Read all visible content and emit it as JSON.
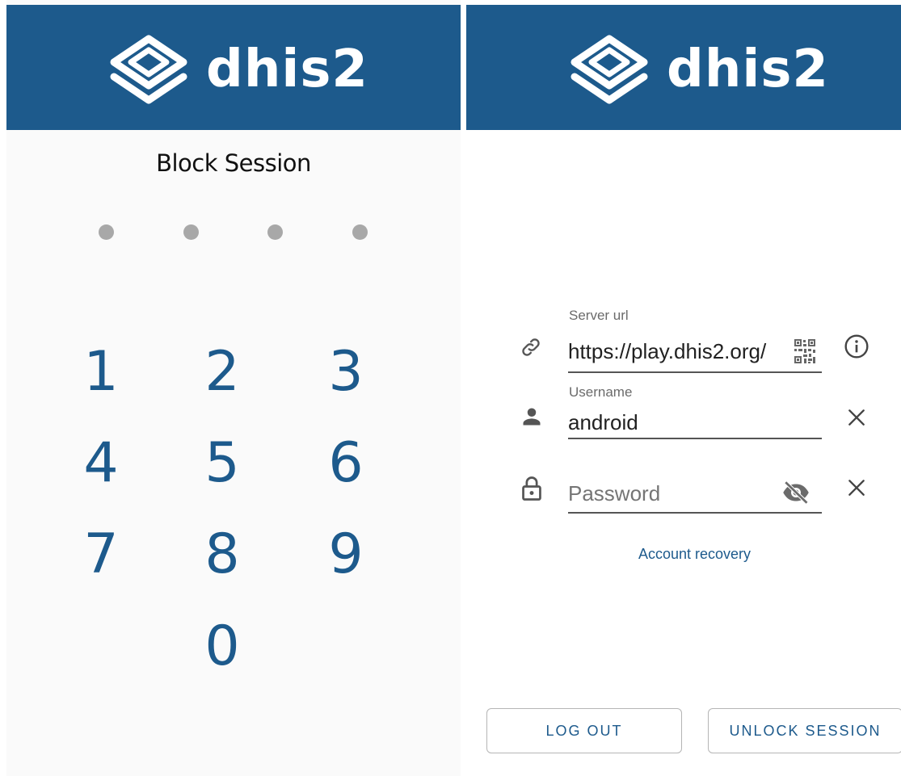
{
  "colors": {
    "brand": "#1d5a8c",
    "pin_dot": "#a8a8a8",
    "text": "#212121",
    "label": "#6b6b6b"
  },
  "left_screen": {
    "logo_text": "dhis2",
    "title": "Block Session",
    "pin_dots": 4,
    "keypad": [
      "1",
      "2",
      "3",
      "4",
      "5",
      "6",
      "7",
      "8",
      "9",
      "0"
    ]
  },
  "right_screen": {
    "logo_text": "dhis2",
    "server_url": {
      "label": "Server url",
      "value": "https://play.dhis2.org/",
      "icon": "link-icon",
      "action_icons": [
        "qr-code-icon",
        "info-icon"
      ]
    },
    "username": {
      "label": "Username",
      "value": "android",
      "icon": "person-icon",
      "clear_icon": "close-icon"
    },
    "password": {
      "placeholder": "Password",
      "value": "",
      "icon": "lock-icon",
      "visibility_icon": "eye-off-icon",
      "clear_icon": "close-icon"
    },
    "account_recovery": "Account recovery",
    "buttons": {
      "log_out": "LOG OUT",
      "unlock": "UNLOCK SESSION"
    }
  }
}
